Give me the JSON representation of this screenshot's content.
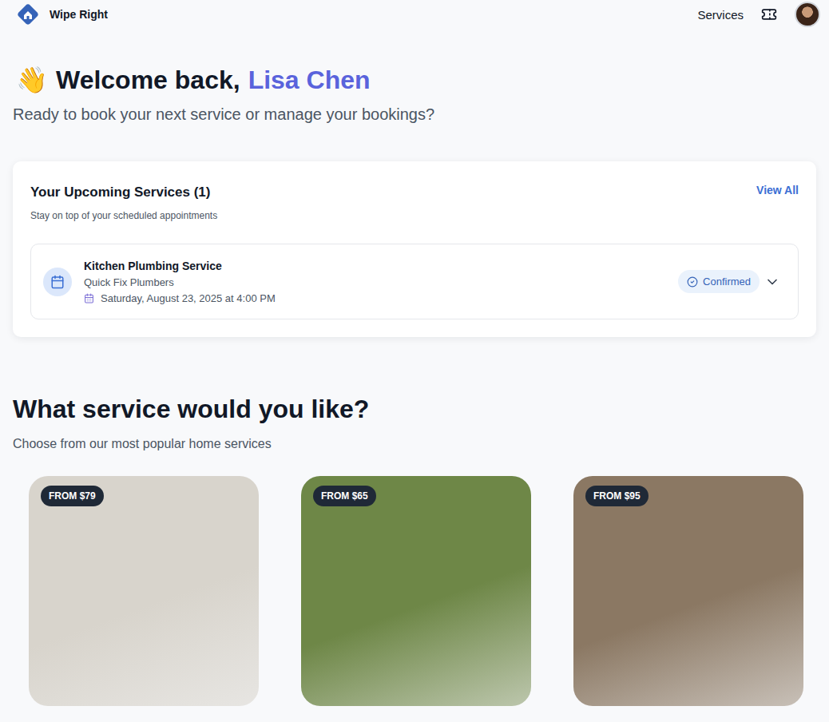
{
  "header": {
    "brand": "Wipe Right",
    "nav": [
      {
        "label": "Services"
      }
    ]
  },
  "welcome": {
    "emoji": "👋",
    "greeting": "Welcome back,",
    "name": "Lisa Chen",
    "subtitle": "Ready to book your next service or manage your bookings?"
  },
  "upcoming": {
    "title": "Your Upcoming Services (1)",
    "subtitle": "Stay on top of your scheduled appointments",
    "view_all": "View All",
    "bookings": [
      {
        "service": "Kitchen Plumbing Service",
        "provider": "Quick Fix Plumbers",
        "date": "Saturday, August 23, 2025 at 4:00 PM",
        "status": "Confirmed",
        "expanded": false
      }
    ]
  },
  "services": {
    "title": "What service would you like?",
    "subtitle": "Choose from our most popular home services",
    "cards": [
      {
        "badge": "FROM $79",
        "color": "#d8d4cc"
      },
      {
        "badge": "FROM $65",
        "color": "#6e8747"
      },
      {
        "badge": "FROM $95",
        "color": "#8b7863"
      }
    ]
  }
}
